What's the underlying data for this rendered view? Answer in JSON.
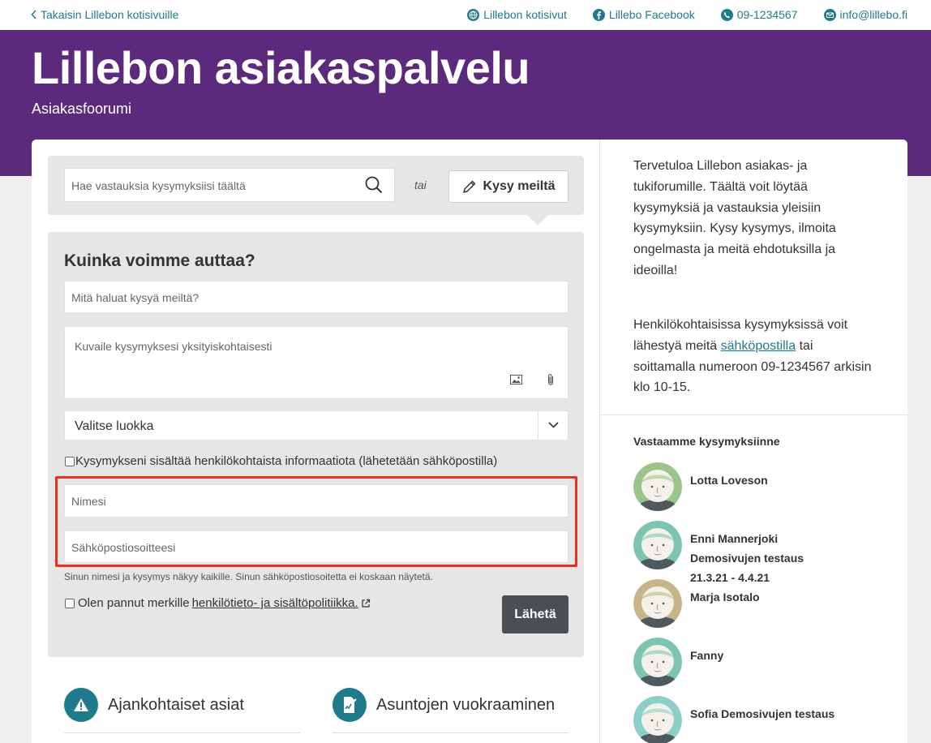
{
  "topbar": {
    "back_label": "Takaisin Lillebon kotisivuille",
    "links": [
      {
        "icon": "globe-icon",
        "label": "Lillebon kotisivut"
      },
      {
        "icon": "facebook-icon",
        "label": "Lillebo Facebook"
      },
      {
        "icon": "phone-icon",
        "label": "09-1234567"
      },
      {
        "icon": "mail-icon",
        "label": "info@lillebo.fi"
      }
    ]
  },
  "hero": {
    "title": "Lillebon asiakaspalvelu",
    "subtitle": "Asiakasfoorumi"
  },
  "search": {
    "placeholder": "Hae vastauksia kysymyksiisi täältä",
    "or_label": "tai",
    "ask_label": "Kysy meiltä"
  },
  "form": {
    "title": "Kuinka voimme auttaa?",
    "question_placeholder": "Mitä haluat kysyä meiltä?",
    "details_placeholder": "Kuvaile kysymyksesi yksityiskohtaisesti",
    "category_value": "Valitse luokka",
    "private_checkbox_label": "Kysymykseni sisältää henkilökohtaista informaatiota (lähetetään sähköpostilla)",
    "name_placeholder": "Nimesi",
    "email_placeholder": "Sähköpostiosoitteesi",
    "note": "Sinun nimesi ja kysymys näkyy kaikille. Sinun sähköpostiosoitetta ei koskaan näytetä.",
    "policy_prefix": "Olen pannut merkille",
    "policy_link": "henkilötieto- ja sisältöpolitiikka.",
    "send_label": "Lähetä"
  },
  "categories": [
    {
      "icon": "warning-icon",
      "label": "Ajankohtaiset asiat"
    },
    {
      "icon": "contract-icon",
      "label": "Asuntojen vuokraaminen"
    }
  ],
  "sidebar": {
    "welcome": "Tervetuloa Lillebon asiakas- ja tukiforumille. Täältä voit löytää kysymyksiä ja vastauksia yleisiin kysymyksiin. Kysy kysymys, ilmoita ongelmasta ja meitä ehdotuksilla ja ideoilla!",
    "personal_prefix": "Henkilökohtaisissa kysymyksissä voit lähestyä meitä",
    "personal_link": "sähköpostilla",
    "personal_suffix": "tai soittamalla numeroon 09-1234567 arkisin klo 10-15.",
    "answer_title": "Vastaamme kysymyksiinne",
    "agents": [
      {
        "name": "Lotta Loveson",
        "ring": "#9bc48a"
      },
      {
        "name": "Enni Mannerjoki Demosivujen testaus 21.3.21 - 4.4.21",
        "ring": "#7ec4b2"
      },
      {
        "name": "Marja Isotalo",
        "ring": "#c7b58a"
      },
      {
        "name": "Fanny",
        "ring": "#7ec4b2"
      },
      {
        "name": "Sofia Demosivujen testaus",
        "ring": "#8ccfc8"
      }
    ]
  },
  "colors": {
    "brand_purple": "#5b2a7d",
    "link_teal": "#1f7a8c",
    "highlight_red": "#e8321f",
    "send_button": "#4a4f53"
  }
}
